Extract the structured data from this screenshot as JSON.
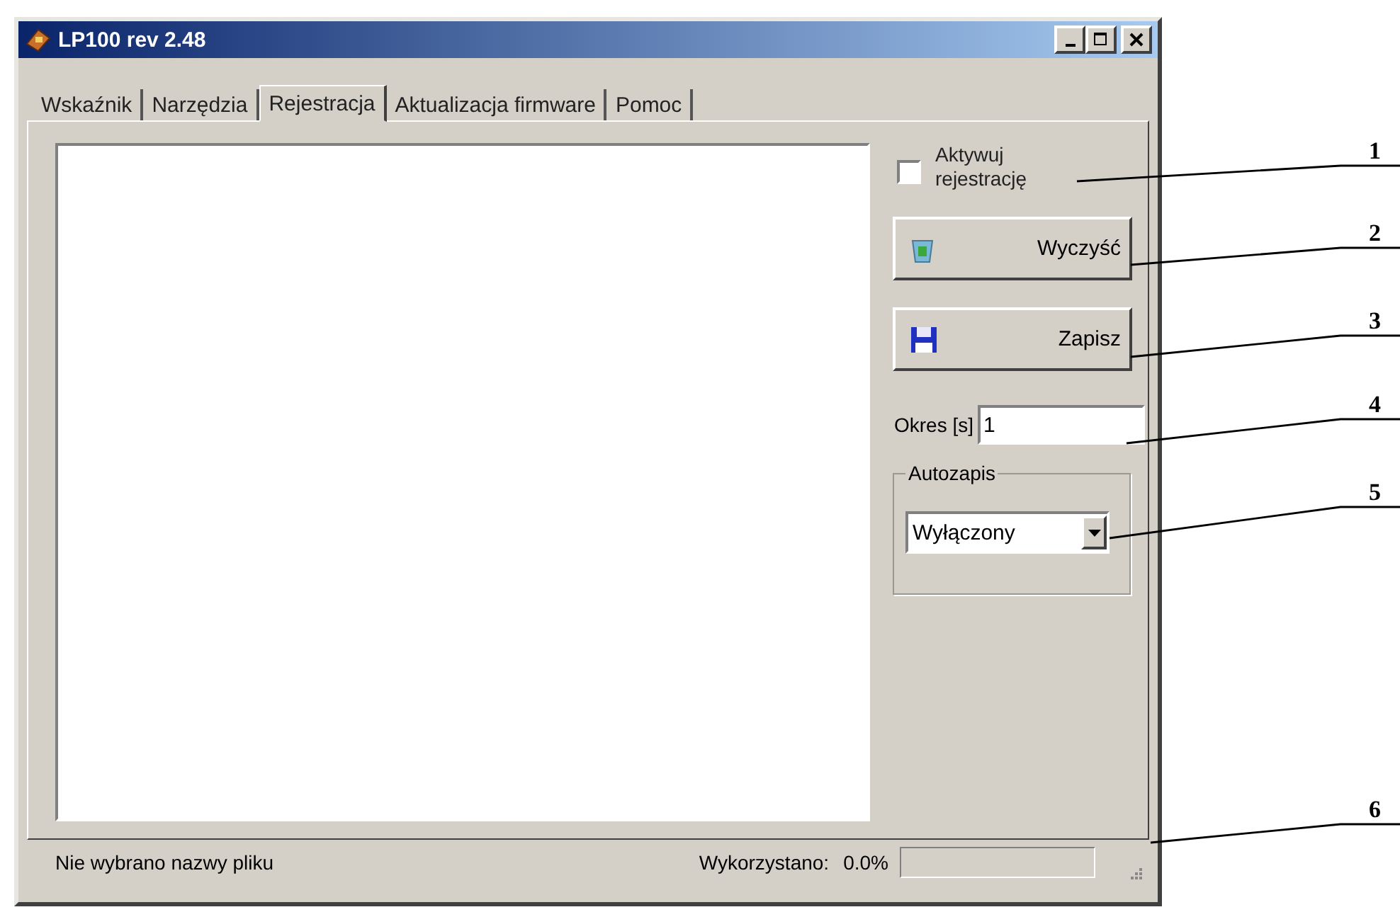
{
  "window": {
    "title": "LP100 rev 2.48"
  },
  "tabs": [
    {
      "label": "Wskaźnik",
      "selected": false
    },
    {
      "label": "Narzędzia",
      "selected": false
    },
    {
      "label": "Rejestracja",
      "selected": true
    },
    {
      "label": "Aktualizacja firmware",
      "selected": false
    },
    {
      "label": "Pomoc",
      "selected": false
    }
  ],
  "activate": {
    "label": "Aktywuj rejestrację",
    "checked": false
  },
  "buttons": [
    {
      "label": "Wyczyść",
      "kind": "clear"
    },
    {
      "label": "Zapisz",
      "kind": "save"
    }
  ],
  "period": {
    "label": "Okres [s]",
    "value": "1"
  },
  "autosave": {
    "label": "Autozapis",
    "value": "Wyłączony"
  },
  "status_bar": {
    "file": "Nie wybrano nazwy pliku",
    "usage_label": "Wykorzystano:",
    "usage_value": "0.0%",
    "level": 0
  },
  "callouts": [
    "1",
    "2",
    "3",
    "4",
    "5",
    "6"
  ]
}
